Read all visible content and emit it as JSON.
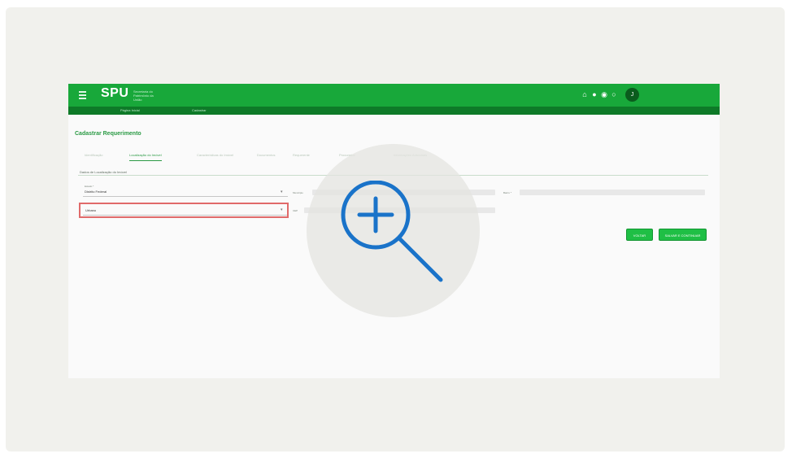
{
  "app": {
    "brand": "SPU",
    "brand_subtitle": "Secretaria do Patrimônio da União",
    "user_initial": "J"
  },
  "subnav": {
    "items": [
      "Página Inicial",
      "Cadastrar"
    ]
  },
  "page": {
    "title": "Cadastrar Requerimento"
  },
  "tabs": [
    {
      "label": "Identificação"
    },
    {
      "label": "Localização do Imóvel"
    },
    {
      "label": "Características do Imóvel"
    },
    {
      "label": "Documentos"
    },
    {
      "label": "Requerente"
    },
    {
      "label": "Procurador"
    },
    {
      "label": "Informações Adicionais"
    }
  ],
  "form": {
    "section_label": "Dados de Localização do Imóvel",
    "uf_label": "Estado *",
    "uf_value": "Distrito Federal",
    "municipio_label": "Município",
    "bairro_label": "Bairro *",
    "tipo_value": "Urbano",
    "cep_label": "CEP"
  },
  "buttons": {
    "voltar": "VOLTAR",
    "salvar": "SALVAR E CONTINUAR"
  },
  "icons": {
    "menu": "menu-icon",
    "zoom": "zoom-in-icon",
    "top": [
      "home-icon",
      "notification-icon",
      "help-icon",
      "info-icon"
    ]
  },
  "colors": {
    "header": "#18a83a",
    "subnav": "#0e7a28",
    "accent": "#2a9a44",
    "highlight": "#e06a6a",
    "zoom": "#1a73c9"
  }
}
